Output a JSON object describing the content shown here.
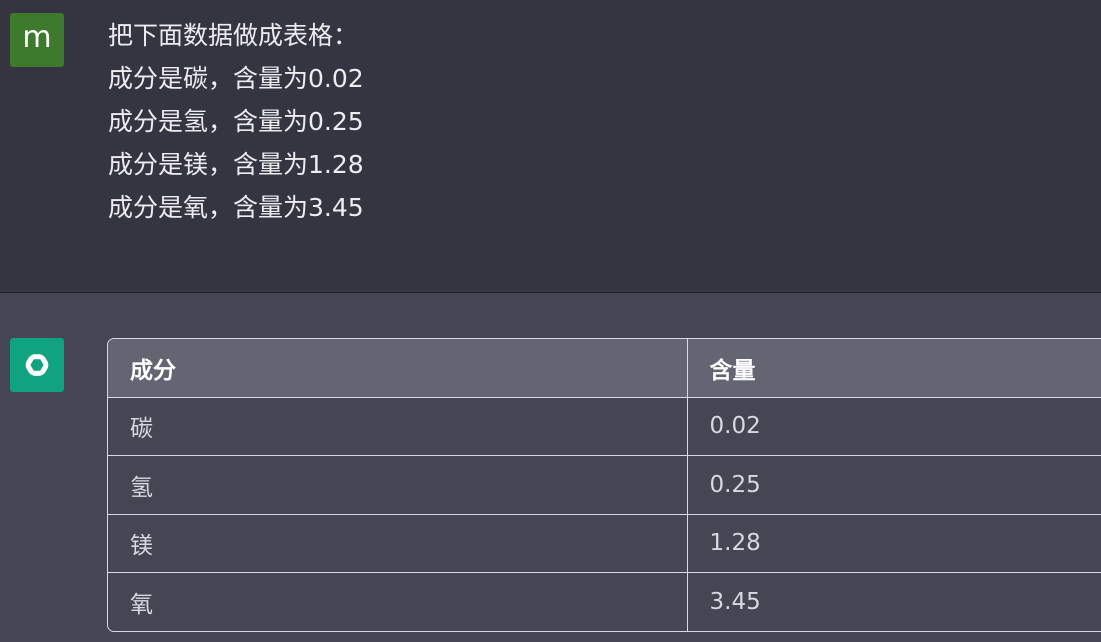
{
  "user": {
    "avatar_letter": "m",
    "avatar_color": "#3d7a2d",
    "message_lines": [
      "把下面数据做成表格：",
      "成分是碳，含量为0.02",
      "成分是氢，含量为0.25",
      "成分是镁，含量为1.28",
      "成分是氧，含量为3.45"
    ]
  },
  "assistant": {
    "avatar_icon": "openai-logo-icon",
    "avatar_color": "#10a37f",
    "table": {
      "headers": [
        "成分",
        "含量"
      ],
      "rows": [
        [
          "碳",
          "0.02"
        ],
        [
          "氢",
          "0.25"
        ],
        [
          "镁",
          "1.28"
        ],
        [
          "氧",
          "3.45"
        ]
      ]
    }
  },
  "colors": {
    "user_bg": "#343541",
    "assistant_bg": "#444654",
    "table_header_bg": "#636572"
  }
}
